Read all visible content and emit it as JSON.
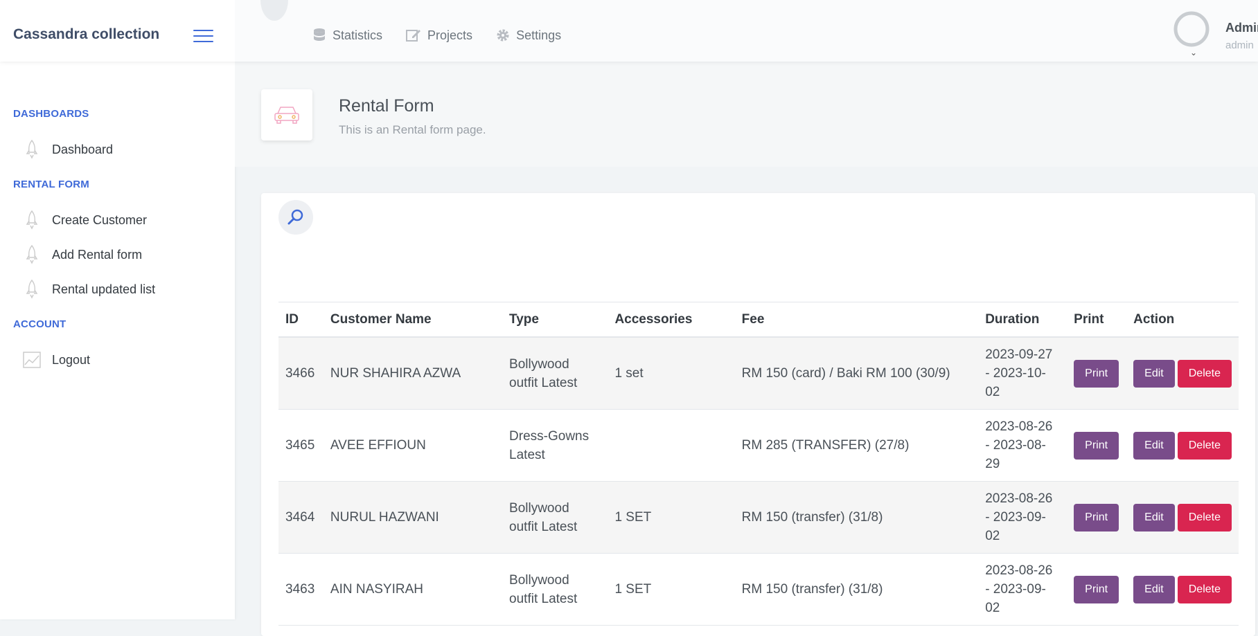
{
  "app": {
    "title": "Cassandra collection"
  },
  "topnav": [
    {
      "label": "Statistics",
      "icon": "database-icon"
    },
    {
      "label": "Projects",
      "icon": "edit-icon"
    },
    {
      "label": "Settings",
      "icon": "gear-icon"
    }
  ],
  "user": {
    "name": "Admin",
    "role": "admin"
  },
  "sidebar": {
    "sections": [
      {
        "heading": "DASHBOARDS",
        "items": [
          {
            "label": "Dashboard",
            "icon": "rocket-icon"
          }
        ]
      },
      {
        "heading": "RENTAL FORM",
        "items": [
          {
            "label": "Create Customer",
            "icon": "rocket-icon"
          },
          {
            "label": "Add Rental form",
            "icon": "rocket-icon"
          },
          {
            "label": "Rental updated list",
            "icon": "rocket-icon"
          }
        ]
      },
      {
        "heading": "ACCOUNT",
        "items": [
          {
            "label": "Logout",
            "icon": "graph-icon"
          }
        ]
      }
    ]
  },
  "page": {
    "title": "Rental Form",
    "subtitle": "This is an Rental form page.",
    "icon": "car-icon"
  },
  "table": {
    "columns": [
      "ID",
      "Customer Name",
      "Type",
      "Accessories",
      "Fee",
      "Duration",
      "Print",
      "Action"
    ],
    "rows": [
      {
        "id": "3466",
        "name": "NUR SHAHIRA AZWA",
        "type": "Bollywood outfit Latest",
        "accessories": "1 set",
        "fee": "RM 150 (card) / Baki RM 100 (30/9)",
        "duration": "2023-09-27 - 2023-10-02"
      },
      {
        "id": "3465",
        "name": "AVEE EFFIOUN",
        "type": "Dress-Gowns Latest",
        "accessories": "",
        "fee": "RM 285 (TRANSFER) (27/8)",
        "duration": "2023-08-26 - 2023-08-29"
      },
      {
        "id": "3464",
        "name": "NURUL HAZWANI",
        "type": "Bollywood outfit Latest",
        "accessories": "1 SET",
        "fee": "RM 150 (transfer) (31/8)",
        "duration": "2023-08-26 - 2023-09-02"
      },
      {
        "id": "3463",
        "name": "AIN NASYIRAH",
        "type": "Bollywood outfit Latest",
        "accessories": "1 SET",
        "fee": "RM 150 (transfer) (31/8)",
        "duration": "2023-08-26 - 2023-09-02"
      }
    ],
    "buttons": {
      "print": "Print",
      "edit": "Edit",
      "delete": "Delete"
    }
  },
  "colors": {
    "accent": "#3f6ad8",
    "purple": "#794c8a",
    "danger": "#d92550"
  }
}
